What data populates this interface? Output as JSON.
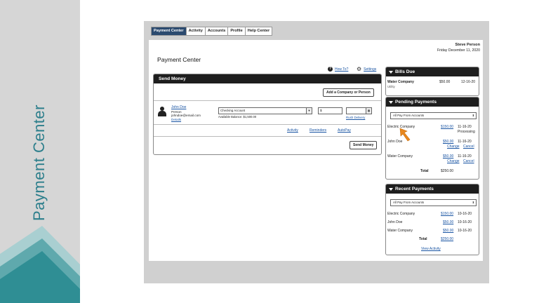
{
  "sidebar": {
    "title": "Payment Center"
  },
  "nav": {
    "tabs": [
      "Payment Center",
      "Activity",
      "Accounts",
      "Profile",
      "Help Center"
    ]
  },
  "user": {
    "name": "Steve Person",
    "date": "Friday December 11, 2020"
  },
  "page": {
    "title": "Payment Center",
    "how_to": "How To?",
    "settings": "Settings"
  },
  "send_money": {
    "header": "Send Money",
    "add_button": "Add a Company or Person",
    "payee": {
      "name": "John Doe",
      "type": "Person",
      "email": "johndoe@email.com",
      "details": "Details"
    },
    "account_select": "Checking Account",
    "balance": "Available Balance: $1,500.00",
    "amount_placeholder": "$",
    "rush_delivery": "Rush Delivery",
    "tabs": [
      "Activity",
      "Reminders",
      "AutoPay"
    ],
    "send_button": "Send Money"
  },
  "bills_due": {
    "header": "Bills Due",
    "item": {
      "name": "Water Company",
      "category": "Utility",
      "amount": "$50.00",
      "date": "12-16-20"
    }
  },
  "pending": {
    "header": "Pending Payments",
    "filter": "All Pay From Accounts",
    "items": [
      {
        "name": "Electric Company",
        "amount": "$150.00",
        "date": "11-16-20",
        "status": "Processing"
      },
      {
        "name": "John Doe",
        "amount": "$50.00",
        "date": "11-16-20",
        "change": "Change",
        "cancel": "Cancel"
      },
      {
        "name": "Water Company",
        "amount": "$50.00",
        "date": "11-16-20",
        "change": "Change",
        "cancel": "Cancel"
      }
    ],
    "total_label": "Total",
    "total": "$250.00"
  },
  "recent": {
    "header": "Recent Payments",
    "filter": "All Pay From Accounts",
    "items": [
      {
        "name": "Electric Company",
        "amount": "$150.00",
        "date": "10-16-20"
      },
      {
        "name": "John Doe",
        "amount": "$50.00",
        "date": "10-16-20"
      },
      {
        "name": "Water Company",
        "amount": "$50.00",
        "date": "10-16-20"
      }
    ],
    "total_label": "Total",
    "total": "$250.00",
    "view_activity": "View Activity"
  },
  "colors": {
    "teal": "#2d7f8c",
    "nav_active": "#2b4a6f",
    "header_dark": "#1e1e1e",
    "link": "#1a55a3",
    "cursor": "#e8871e"
  }
}
